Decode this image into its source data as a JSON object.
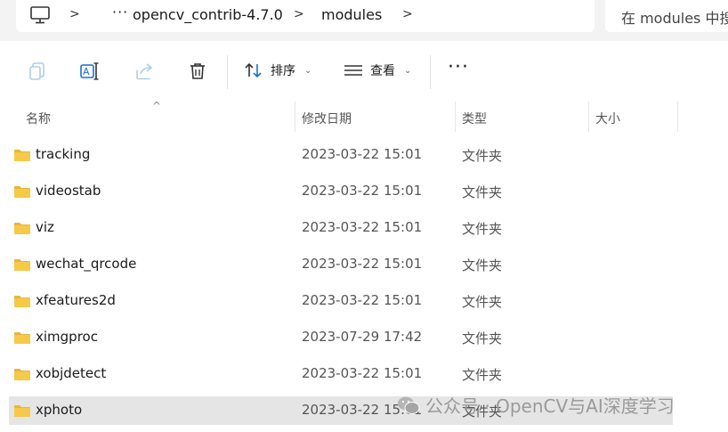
{
  "breadcrumb": {
    "items": [
      "opencv_contrib-4.7.0",
      "modules"
    ],
    "separator": ">",
    "overflow": "···"
  },
  "search": {
    "placeholder": "在 modules 中搜"
  },
  "toolbar": {
    "sort_label": "排序",
    "view_label": "查看",
    "more": "···"
  },
  "columns": {
    "name": "名称",
    "modified": "修改日期",
    "type": "类型",
    "size": "大小"
  },
  "files": [
    {
      "name": "tracking",
      "modified": "2023-03-22 15:01",
      "type": "文件夹"
    },
    {
      "name": "videostab",
      "modified": "2023-03-22 15:01",
      "type": "文件夹"
    },
    {
      "name": "viz",
      "modified": "2023-03-22 15:01",
      "type": "文件夹"
    },
    {
      "name": "wechat_qrcode",
      "modified": "2023-03-22 15:01",
      "type": "文件夹"
    },
    {
      "name": "xfeatures2d",
      "modified": "2023-03-22 15:01",
      "type": "文件夹"
    },
    {
      "name": "ximgproc",
      "modified": "2023-07-29 17:42",
      "type": "文件夹"
    },
    {
      "name": "xobjdetect",
      "modified": "2023-03-22 15:01",
      "type": "文件夹"
    },
    {
      "name": "xphoto",
      "modified": "2023-03-22 15:01",
      "type": "文件夹",
      "selected": true
    }
  ],
  "watermark": "公众号 · OpenCV与AI深度学习",
  "colors": {
    "folder": "#f7c948",
    "folder_tab": "#e8b53a",
    "selected_row": "#e5e5e5"
  }
}
